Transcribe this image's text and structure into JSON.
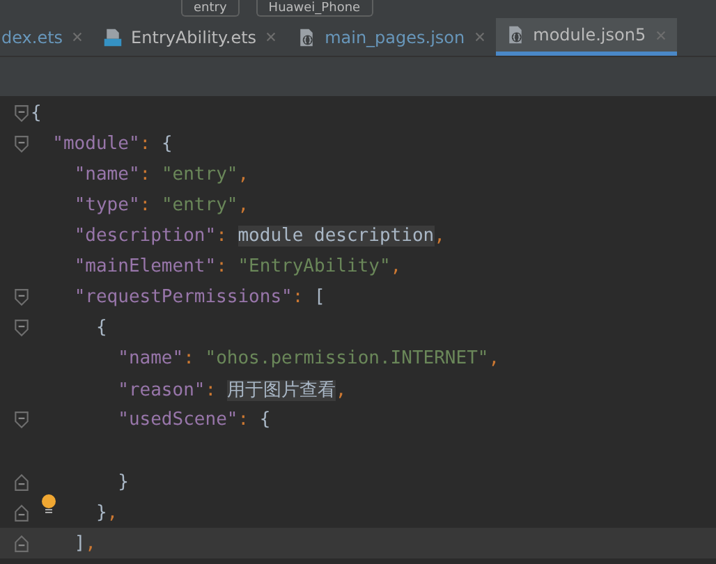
{
  "toolbar": {
    "module_selector": "entry",
    "device_selector": "Huawei_Phone"
  },
  "tabs": [
    {
      "label": "dex.ets",
      "kind": "plain",
      "color": "#6897bb",
      "selected": false
    },
    {
      "label": "EntryAbility.ets",
      "kind": "ets",
      "color": "#bbbbbb",
      "selected": false
    },
    {
      "label": "main_pages.json",
      "kind": "json",
      "color": "#6897bb",
      "selected": false
    },
    {
      "label": "module.json5",
      "kind": "json",
      "color": "#bbbbbb",
      "selected": true
    }
  ],
  "editor": {
    "lines": [
      {
        "kind": "fold-start",
        "bulb": false,
        "current": false,
        "tokens": [
          {
            "kind": "brace",
            "text": "{"
          }
        ]
      },
      {
        "kind": "fold-start",
        "bulb": false,
        "current": false,
        "tokens": [
          {
            "kind": "key",
            "text": "  \"module\""
          },
          {
            "kind": "punct",
            "text": ": "
          },
          {
            "kind": "brace",
            "text": "{"
          }
        ]
      },
      {
        "kind": "plain",
        "bulb": false,
        "current": false,
        "tokens": [
          {
            "kind": "key",
            "text": "    \"name\""
          },
          {
            "kind": "punct",
            "text": ": "
          },
          {
            "kind": "string",
            "text": "\"entry\""
          },
          {
            "kind": "punct",
            "text": ","
          }
        ]
      },
      {
        "kind": "plain",
        "bulb": false,
        "current": false,
        "tokens": [
          {
            "kind": "key",
            "text": "    \"type\""
          },
          {
            "kind": "punct",
            "text": ": "
          },
          {
            "kind": "string",
            "text": "\"entry\""
          },
          {
            "kind": "punct",
            "text": ","
          }
        ]
      },
      {
        "kind": "plain",
        "bulb": false,
        "current": false,
        "tokens": [
          {
            "kind": "key",
            "text": "    \"description\""
          },
          {
            "kind": "punct",
            "text": ": "
          },
          {
            "kind": "hint",
            "text": "module description"
          },
          {
            "kind": "punct",
            "text": ","
          }
        ]
      },
      {
        "kind": "plain",
        "bulb": false,
        "current": false,
        "tokens": [
          {
            "kind": "key",
            "text": "    \"mainElement\""
          },
          {
            "kind": "punct",
            "text": ": "
          },
          {
            "kind": "string",
            "text": "\"EntryAbility\""
          },
          {
            "kind": "punct",
            "text": ","
          }
        ]
      },
      {
        "kind": "fold-start",
        "bulb": false,
        "current": false,
        "tokens": [
          {
            "kind": "key",
            "text": "    \"requestPermissions\""
          },
          {
            "kind": "punct",
            "text": ": "
          },
          {
            "kind": "brace",
            "text": "["
          }
        ]
      },
      {
        "kind": "fold-start",
        "bulb": false,
        "current": false,
        "tokens": [
          {
            "kind": "brace",
            "text": "      {"
          }
        ]
      },
      {
        "kind": "plain",
        "bulb": false,
        "current": false,
        "tokens": [
          {
            "kind": "key",
            "text": "        \"name\""
          },
          {
            "kind": "punct",
            "text": ": "
          },
          {
            "kind": "string",
            "text": "\"ohos.permission.INTERNET\""
          },
          {
            "kind": "punct",
            "text": ","
          }
        ]
      },
      {
        "kind": "plain",
        "bulb": false,
        "current": false,
        "tokens": [
          {
            "kind": "key",
            "text": "        \"reason\""
          },
          {
            "kind": "punct",
            "text": ": "
          },
          {
            "kind": "hint",
            "text": "用于图片查看"
          },
          {
            "kind": "punct",
            "text": ","
          }
        ]
      },
      {
        "kind": "fold-start",
        "bulb": false,
        "current": false,
        "tokens": [
          {
            "kind": "key",
            "text": "        \"usedScene\""
          },
          {
            "kind": "punct",
            "text": ": "
          },
          {
            "kind": "brace",
            "text": "{"
          }
        ]
      },
      {
        "kind": "plain",
        "bulb": false,
        "current": false
      },
      {
        "kind": "fold-end",
        "bulb": false,
        "current": false,
        "tokens": [
          {
            "kind": "brace",
            "text": "        }"
          }
        ]
      },
      {
        "kind": "fold-end",
        "bulb": true,
        "current": false,
        "tokens": [
          {
            "kind": "brace",
            "text": "      }"
          },
          {
            "kind": "punct",
            "text": ","
          }
        ]
      },
      {
        "kind": "fold-end",
        "bulb": false,
        "current": true,
        "tokens": [
          {
            "kind": "brace",
            "text": "    ]"
          },
          {
            "kind": "punct",
            "text": ","
          }
        ]
      }
    ]
  }
}
